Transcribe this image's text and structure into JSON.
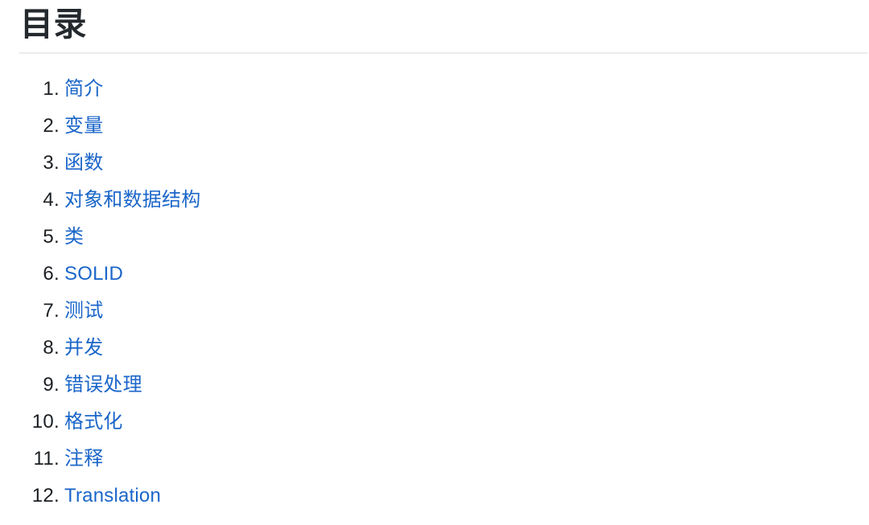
{
  "document": {
    "heading": "目录",
    "accent_color": "#1b66c9",
    "text_color": "#24292e",
    "rule_color": "#eaecef",
    "background_color": "#ffffff"
  },
  "toc": {
    "items": [
      {
        "marker": "1.",
        "label": "简介"
      },
      {
        "marker": "2.",
        "label": "变量"
      },
      {
        "marker": "3.",
        "label": "函数"
      },
      {
        "marker": "4.",
        "label": "对象和数据结构"
      },
      {
        "marker": "5.",
        "label": "类"
      },
      {
        "marker": "6.",
        "label": "SOLID"
      },
      {
        "marker": "7.",
        "label": "测试"
      },
      {
        "marker": "8.",
        "label": "并发"
      },
      {
        "marker": "9.",
        "label": "错误处理"
      },
      {
        "marker": "10.",
        "label": "格式化"
      },
      {
        "marker": "11.",
        "label": "注释"
      },
      {
        "marker": "12.",
        "label": "Translation"
      }
    ]
  }
}
